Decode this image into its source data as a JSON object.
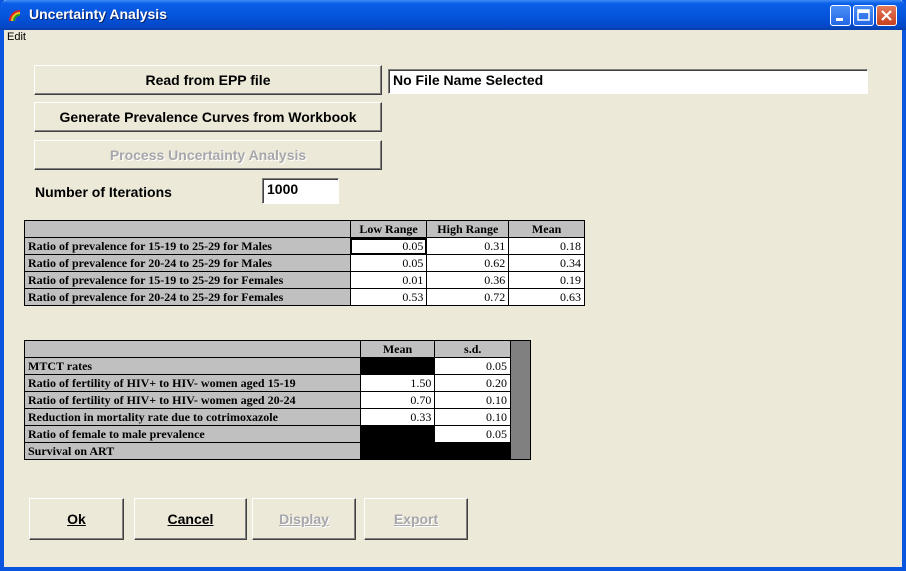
{
  "window": {
    "title": "Uncertainty Analysis",
    "menu": [
      "Edit"
    ],
    "title_color": "#0a55e0"
  },
  "buttons": {
    "read_epp": "Read from EPP file",
    "generate_curves": "Generate Prevalence Curves from Workbook",
    "process": "Process Uncertainty Analysis",
    "ok": "Ok",
    "cancel": "Cancel",
    "display": "Display",
    "export": "Export"
  },
  "file_name": "No File Name Selected",
  "iterations": {
    "label": "Number of Iterations",
    "value": "1000"
  },
  "ratio_table": {
    "headers": [
      "Low Range",
      "High Range",
      "Mean"
    ],
    "rows": [
      {
        "label": "Ratio of prevalence for 15-19 to 25-29 for Males",
        "low": "0.05",
        "high": "0.31",
        "mean": "0.18"
      },
      {
        "label": "Ratio of prevalence for 20-24 to 25-29 for Males",
        "low": "0.05",
        "high": "0.62",
        "mean": "0.34"
      },
      {
        "label": "Ratio of prevalence for 15-19 to 25-29 for Females",
        "low": "0.01",
        "high": "0.36",
        "mean": "0.19"
      },
      {
        "label": "Ratio of prevalence for 20-24 to 25-29 for Females",
        "low": "0.53",
        "high": "0.72",
        "mean": "0.63"
      }
    ]
  },
  "rates_table": {
    "headers": [
      "Mean",
      "s.d."
    ],
    "rows": [
      {
        "label": "MTCT rates",
        "mean": "",
        "sd": "0.05"
      },
      {
        "label": "Ratio of fertility of HIV+ to HIV- women aged 15-19",
        "mean": "1.50",
        "sd": "0.20"
      },
      {
        "label": "Ratio of fertility of HIV+ to HIV- women aged 20-24",
        "mean": "0.70",
        "sd": "0.10"
      },
      {
        "label": "Reduction in mortality rate due to cotrimoxazole",
        "mean": "0.33",
        "sd": "0.10"
      },
      {
        "label": "Ratio of female to male prevalence",
        "mean": "",
        "sd": "0.05"
      },
      {
        "label": "Survival on ART",
        "mean": "",
        "sd": ""
      }
    ]
  }
}
